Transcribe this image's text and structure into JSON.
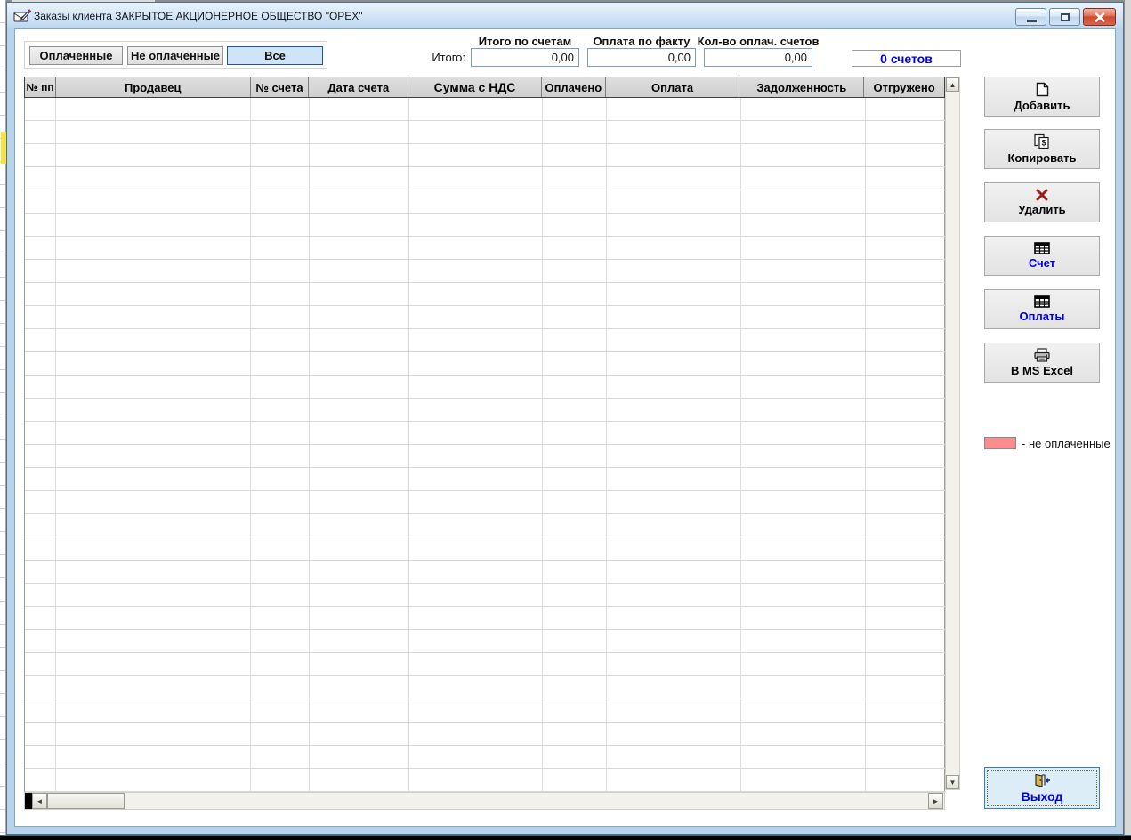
{
  "window": {
    "title": "Заказы клиента ЗАКРЫТОЕ АКЦИОНЕРНОЕ ОБЩЕСТВО \"ОРЕХ\"",
    "icon": "mail-pen-icon",
    "controls": {
      "minimize": "minimize-icon",
      "restore": "restore-icon",
      "close": "close-x-icon"
    }
  },
  "filters": {
    "paid": "Оплаченные",
    "unpaid": "Не оплаченные",
    "all": "Все",
    "active": "Все"
  },
  "summary": {
    "total_label": "Итого:",
    "fields": [
      {
        "label": "Итого по счетам",
        "value": "0,00"
      },
      {
        "label": "Оплата по факту",
        "value": "0,00"
      },
      {
        "label": "Кол-во оплач. счетов",
        "value": "0,00"
      }
    ],
    "invoice_count": "0 счетов"
  },
  "table": {
    "columns": [
      "№ пп",
      "Продавец",
      "№ счета",
      "Дата счета",
      "Сумма с НДС",
      "Оплачено",
      "Оплата",
      "Задолженность",
      "Отгружено"
    ],
    "rows": [],
    "visible_row_count": 30
  },
  "actions": [
    {
      "label": "Добавить",
      "icon": "new-document-icon"
    },
    {
      "label": "Копировать",
      "icon": "copy-document-icon"
    },
    {
      "label": "Удалить",
      "icon": "delete-x-icon"
    },
    {
      "label": "Счет",
      "icon": "invoice-table-icon"
    },
    {
      "label": "Оплаты",
      "icon": "payments-table-icon"
    },
    {
      "label": "В MS Excel",
      "icon": "printer-icon"
    }
  ],
  "legend": {
    "swatch_color": "#fa8e8e",
    "label": "- не оплаченные"
  },
  "exit": {
    "label": "Выход",
    "icon": "exit-door-icon"
  },
  "scrollbars": {
    "up": "▲",
    "down": "▼",
    "left": "◄",
    "right": "►"
  },
  "colors": {
    "selected_filter_bg": "#cfe4f7",
    "selected_filter_border": "#23549b",
    "link_blue": "#0000f0",
    "count_blue": "#0000e0",
    "unpaid_swatch": "#fa8e8e",
    "titlebar_gradient_top": "#eaf3fc",
    "titlebar_gradient_bottom": "#bcd6ee"
  }
}
